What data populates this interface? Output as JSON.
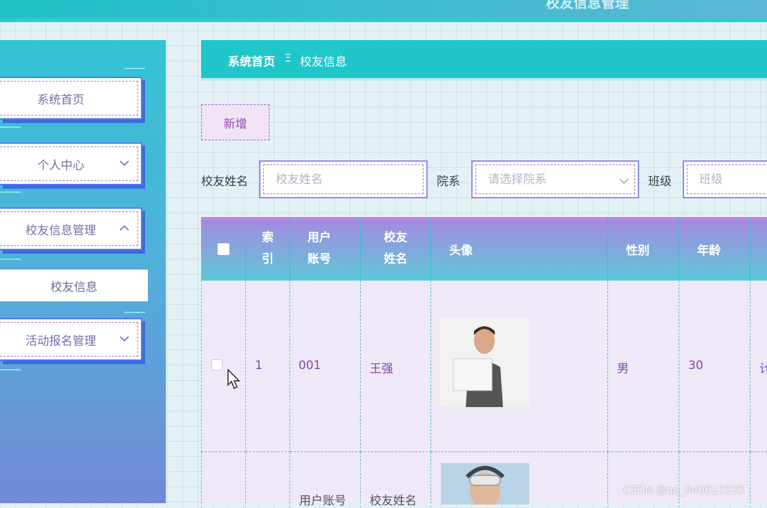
{
  "header": {
    "title": "校友信息管理"
  },
  "sidebar": {
    "items": [
      {
        "label": "系统首页"
      },
      {
        "label": "个人中心"
      },
      {
        "label": "校友信息管理"
      },
      {
        "label": "活动报名管理"
      }
    ],
    "subitem": {
      "label": "校友信息"
    }
  },
  "breadcrumb": {
    "home": "系统首页",
    "separator": "Ξ",
    "current": "校友信息"
  },
  "toolbar": {
    "add_label": "新增"
  },
  "search": {
    "name_label": "校友姓名",
    "name_placeholder": "校友姓名",
    "dept_label": "院系",
    "dept_placeholder": "请选择院系",
    "class_label": "班级",
    "class_placeholder": "班级"
  },
  "table": {
    "columns": [
      "索引",
      "用户账号",
      "校友姓名",
      "头像",
      "性别",
      "年龄"
    ],
    "index_parts": [
      "索",
      "引"
    ],
    "account_parts": [
      "用户",
      "账号"
    ],
    "name_parts": [
      "校友",
      "姓名"
    ],
    "rows": [
      {
        "index": "1",
        "account": "001",
        "name": "王强",
        "gender": "男",
        "age": "30",
        "extra": "计"
      },
      {
        "account": "用户账号",
        "name": "校友姓名"
      }
    ]
  },
  "watermark": "CSDN @qq_840612233",
  "colors": {
    "accent": "#1fc7cb",
    "menu_text": "#7a6aa8",
    "cell_text": "#7c4aa8"
  }
}
